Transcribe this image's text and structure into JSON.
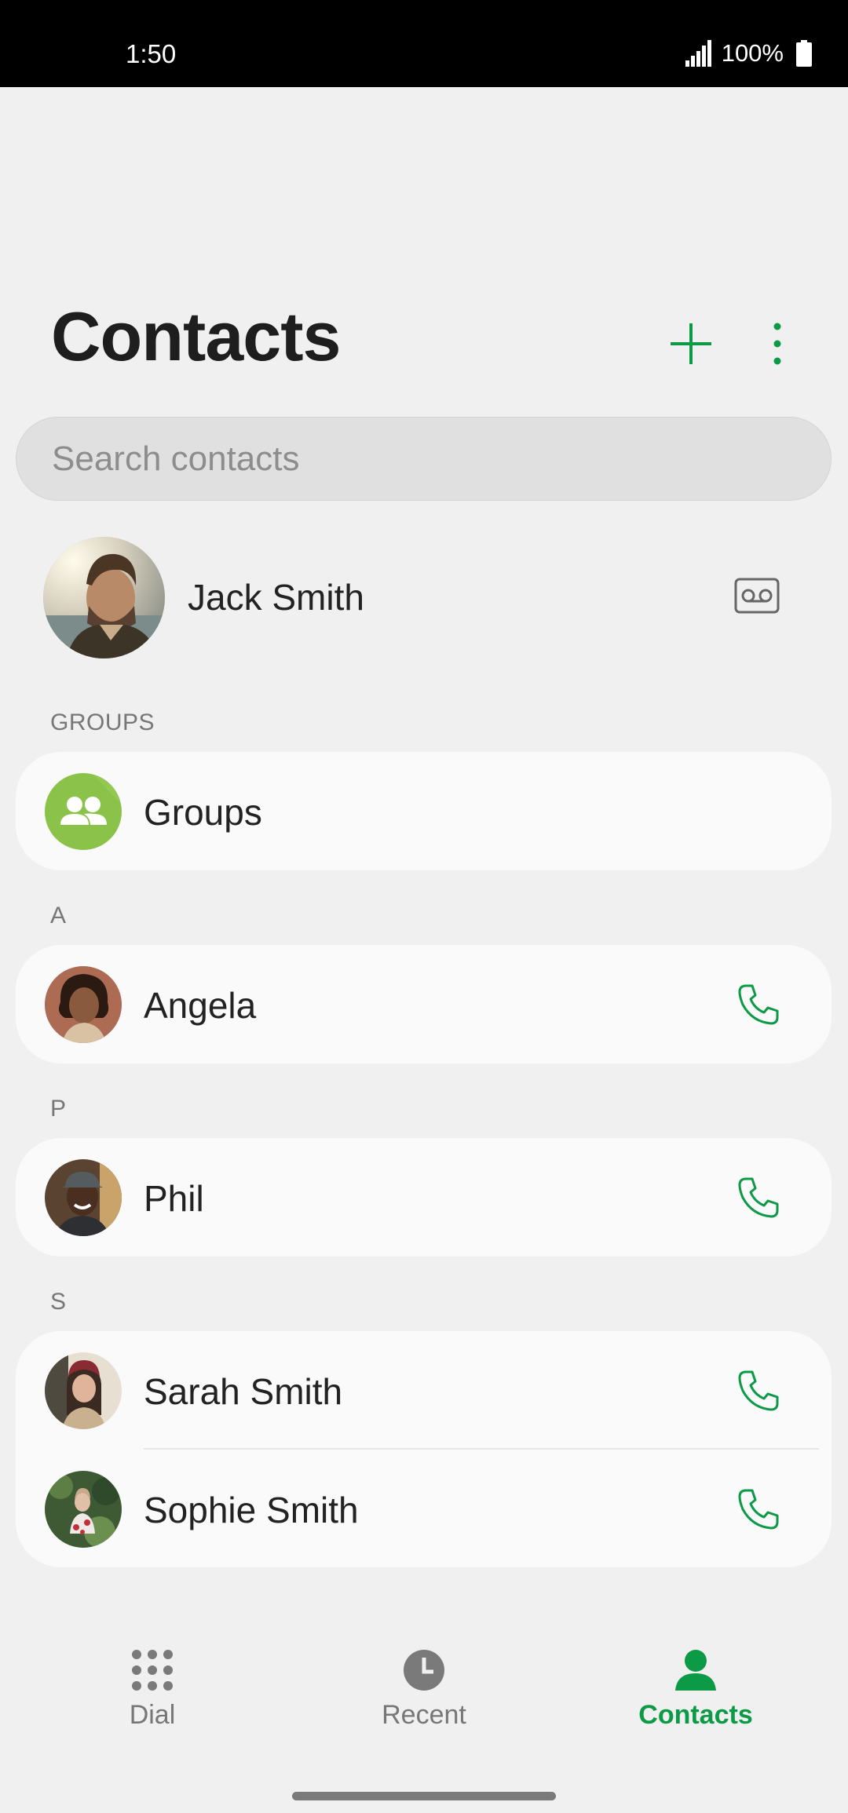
{
  "status_bar": {
    "time": "1:50",
    "battery": "100%",
    "icons": [
      "signal-icon",
      "battery-icon"
    ]
  },
  "header": {
    "title": "Contacts",
    "add_icon": "plus-icon",
    "more_icon": "more-vertical-icon"
  },
  "search": {
    "placeholder": "Search contacts",
    "value": ""
  },
  "profile": {
    "name": "Jack Smith",
    "avatar_icon": "profile-photo",
    "action_icon": "voicemail-icon"
  },
  "sections": [
    {
      "label": "GROUPS",
      "items": [
        {
          "name": "Groups",
          "icon": "groups-icon"
        }
      ]
    },
    {
      "label": "A",
      "items": [
        {
          "name": "Angela",
          "icon": "phone-icon"
        }
      ]
    },
    {
      "label": "P",
      "items": [
        {
          "name": "Phil",
          "icon": "phone-icon"
        }
      ]
    },
    {
      "label": "S",
      "items": [
        {
          "name": "Sarah Smith",
          "icon": "phone-icon"
        },
        {
          "name": "Sophie Smith",
          "icon": "phone-icon"
        }
      ]
    }
  ],
  "bottom_nav": [
    {
      "label": "Dial",
      "icon": "dialpad-icon",
      "active": false
    },
    {
      "label": "Recent",
      "icon": "clock-icon",
      "active": false
    },
    {
      "label": "Contacts",
      "icon": "person-icon",
      "active": true
    }
  ],
  "colors": {
    "accent": "#0c9a47",
    "background": "#f0f0f0",
    "card": "#fafafa",
    "groups_avatar": "#8bc34a"
  }
}
